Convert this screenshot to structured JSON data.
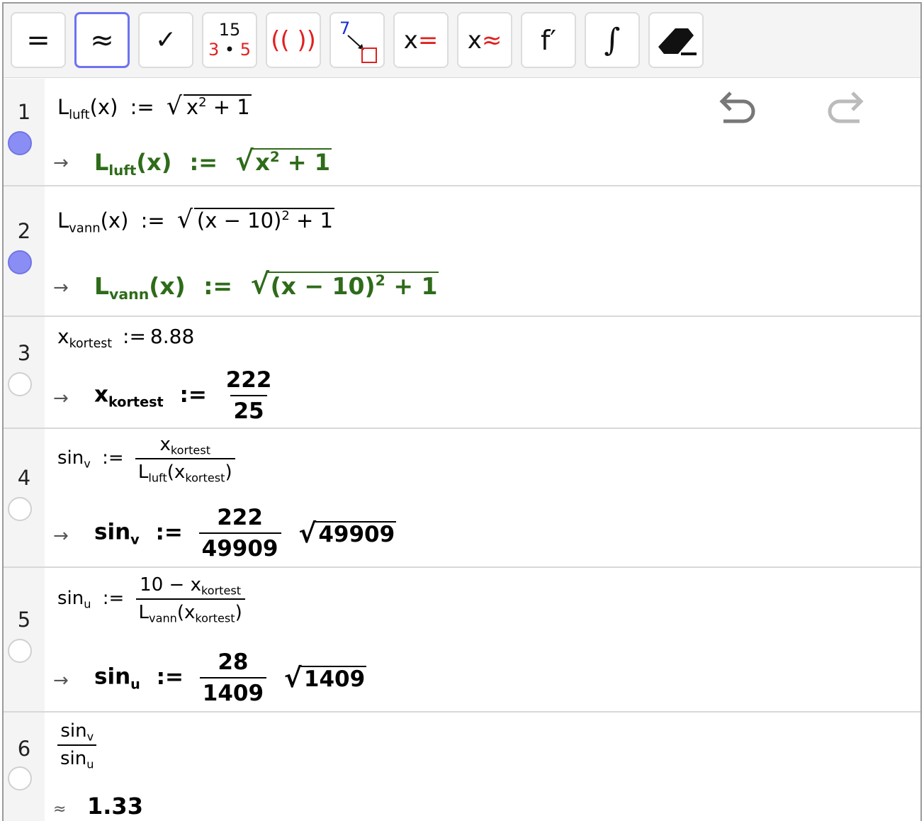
{
  "toolbar": {
    "buttons": [
      {
        "name": "evaluate-button",
        "label": "="
      },
      {
        "name": "numeric-button",
        "label": "≈",
        "active": true
      },
      {
        "name": "keep-input-button",
        "label": "✓"
      },
      {
        "name": "factor-button",
        "top": "15",
        "bottom_left": "3",
        "dot": "•",
        "bottom_right": "5"
      },
      {
        "name": "expand-button",
        "label": "(( ))"
      },
      {
        "name": "substitute-button",
        "top": "7"
      },
      {
        "name": "solve-button",
        "x": "x",
        "sym": "="
      },
      {
        "name": "solve-numerically-button",
        "x": "x",
        "sym": "≈"
      },
      {
        "name": "derivative-button",
        "label": "f′"
      },
      {
        "name": "integral-button",
        "label": "∫"
      },
      {
        "name": "delete-button",
        "label": ""
      }
    ]
  },
  "rows": [
    {
      "number": "1",
      "selected": true
    },
    {
      "number": "2",
      "selected": true
    },
    {
      "number": "3",
      "selected": false
    },
    {
      "number": "4",
      "selected": false
    },
    {
      "number": "5",
      "selected": false
    },
    {
      "number": "6",
      "selected": false
    }
  ],
  "text": {
    "L": "L",
    "luft": "luft",
    "vann": "vann",
    "x": "x",
    "kortest": "kortest",
    "sin": "sin",
    "v": "v",
    "u": "u",
    "assign": ":=",
    "arrow": "→",
    "approx": "≈",
    "two": "2",
    "plus1": "+ 1",
    "sqrt": "√",
    "r1_arg": "(x)",
    "r2_lparen": "(x − 10)",
    "r3_input_val": "8.88",
    "r3_num": "222",
    "r3_den": "25",
    "r4_num": "222",
    "r4_den": "49909",
    "r4_root": "49909",
    "r5_num_prefix": "10 − ",
    "r5_num": "28",
    "r5_den": "1409",
    "r5_root": "1409",
    "r6_result": "1.33"
  },
  "colors": {
    "accent": "#6e72f0",
    "output_green": "#2e6b1a",
    "selected_dot": "#8a8ef4"
  },
  "icons": [
    "undo-icon",
    "redo-icon",
    "eraser-icon",
    "substitute-icon"
  ]
}
